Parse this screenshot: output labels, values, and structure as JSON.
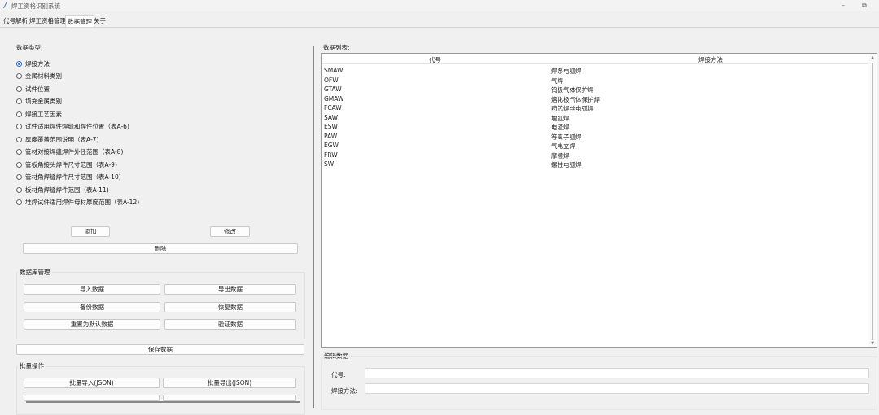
{
  "window": {
    "title": "焊工资格识别系统",
    "minimize": "–",
    "maximize": "⧉"
  },
  "tabs": [
    "代号解析",
    "焊工资格管理",
    "数据管理",
    "关于"
  ],
  "active_tab": "数据管理",
  "left": {
    "data_type_label": "数据类型:",
    "radios": [
      "焊接方法",
      "金属材料类别",
      "试件位置",
      "填充金属类别",
      "焊接工艺因素",
      "试件适用焊件焊缝和焊件位置（表A-6)",
      "厚度覆盖范围说明（表A-7)",
      "管材对接焊缝焊件外径范围（表A-8)",
      "管板角接头焊件尺寸范围（表A-9)",
      "管材角焊缝焊件尺寸范围（表A-10)",
      "板材角焊缝焊件范围（表A-11)",
      "堆焊试件适用焊件母材厚度范围（表A-12)"
    ],
    "selected_index": 0,
    "add_label": "添加",
    "edit_label": "修改",
    "delete_label": "删除",
    "db_group_title": "数据库管理",
    "import_label": "导入数据",
    "export_label": "导出数据",
    "backup_label": "备份数据",
    "restore_label": "恢复数据",
    "reset_label": "重置为默认数据",
    "validate_label": "验证数据",
    "save_label": "保存数据",
    "batch_group_title": "批量操作",
    "batch_import_label": "批量导入(JSON)",
    "batch_export_label": "批量导出(JSON)"
  },
  "right": {
    "list_label": "数据列表:",
    "columns": [
      "代号",
      "焊接方法"
    ],
    "rows": [
      [
        "SMAW",
        "焊条电弧焊"
      ],
      [
        "OFW",
        "气焊"
      ],
      [
        "GTAW",
        "钨极气体保护焊"
      ],
      [
        "GMAW",
        "熔化极气体保护焊"
      ],
      [
        "FCAW",
        "药芯焊丝电弧焊"
      ],
      [
        "SAW",
        "埋弧焊"
      ],
      [
        "ESW",
        "电渣焊"
      ],
      [
        "PAW",
        "等离子弧焊"
      ],
      [
        "EGW",
        "气电立焊"
      ],
      [
        "FRW",
        "摩擦焊"
      ],
      [
        "SW",
        "螺柱电弧焊"
      ]
    ],
    "scroll_up": "▲",
    "scroll_down": "▼",
    "edit_group_title": "编辑数据",
    "code_label": "代号:",
    "method_label": "焊接方法:",
    "code_value": "",
    "method_value": ""
  },
  "colors": {
    "accent": "#2b6cd4",
    "panel_bg": "#f0f0f0",
    "list_bg": "#ffffff"
  }
}
